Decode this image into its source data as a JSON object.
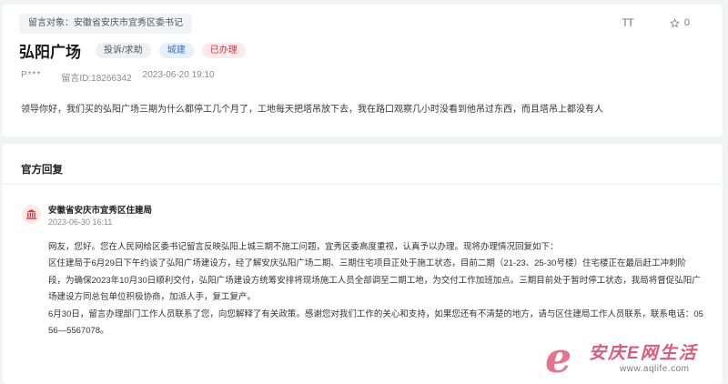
{
  "message": {
    "target_label": "留言对象：安徽省安庆市宜秀区委书记",
    "font_size_label": "TT",
    "favorite_count": "0",
    "title": "弘阳广场",
    "tags": [
      "投诉/求助",
      "城建",
      "已办理"
    ],
    "author": "P***",
    "message_id": "留言ID:18266342",
    "datetime": "2023-06-20 19:10",
    "content": "领导你好，我们买的弘阳广场三期为什么都停工几个月了，工地每天把塔吊放下去，我在路口观察几小时没看到他吊过东西，而且塔吊上都没有人"
  },
  "reply": {
    "section_title": "官方回复",
    "org_name": "安徽省安庆市宜秀区住建局",
    "datetime": "2023-06-30 16:11",
    "lines": [
      "网友，您好。您在人民网给区委书记留言反映弘阳上城三期不施工问题，宜秀区委高度重视，认真予以办理。现将办理情况回复如下：",
      "区住建局于6月29日下午约谈了弘阳广场建设方，经了解安庆弘阳广场二期、三期住宅项目正处于施工状态，目前二期（21-23、25-30号楼）住宅楼正在最后赶工冲刺阶",
      "段，为确保2023年10月30日顺利交付，弘阳广场建设方统筹安排将现场施工人员全部调至二期工地，为交付工作加班加点。三期目前处于暂时停工状态，我局将督促弘阳广",
      "场建设方同总包单位积极协商，加派人手，复工复产。",
      "6月30日，留言办理部门工作人员联系了您，向您解释了有关政策。感谢您对我们工作的关心和支持，如果您还有不清楚的地方，请与区住建局工作人员联系，联系电话：05",
      "56—5567078。"
    ]
  },
  "watermark": {
    "letter": "e",
    "name": "安庆E网生活",
    "url": "www.aqlife.com"
  },
  "colors": {
    "accent_red": "#d9363e",
    "tag_blue": "#3a6fc8",
    "watermark_pink": "#e15b7a"
  }
}
